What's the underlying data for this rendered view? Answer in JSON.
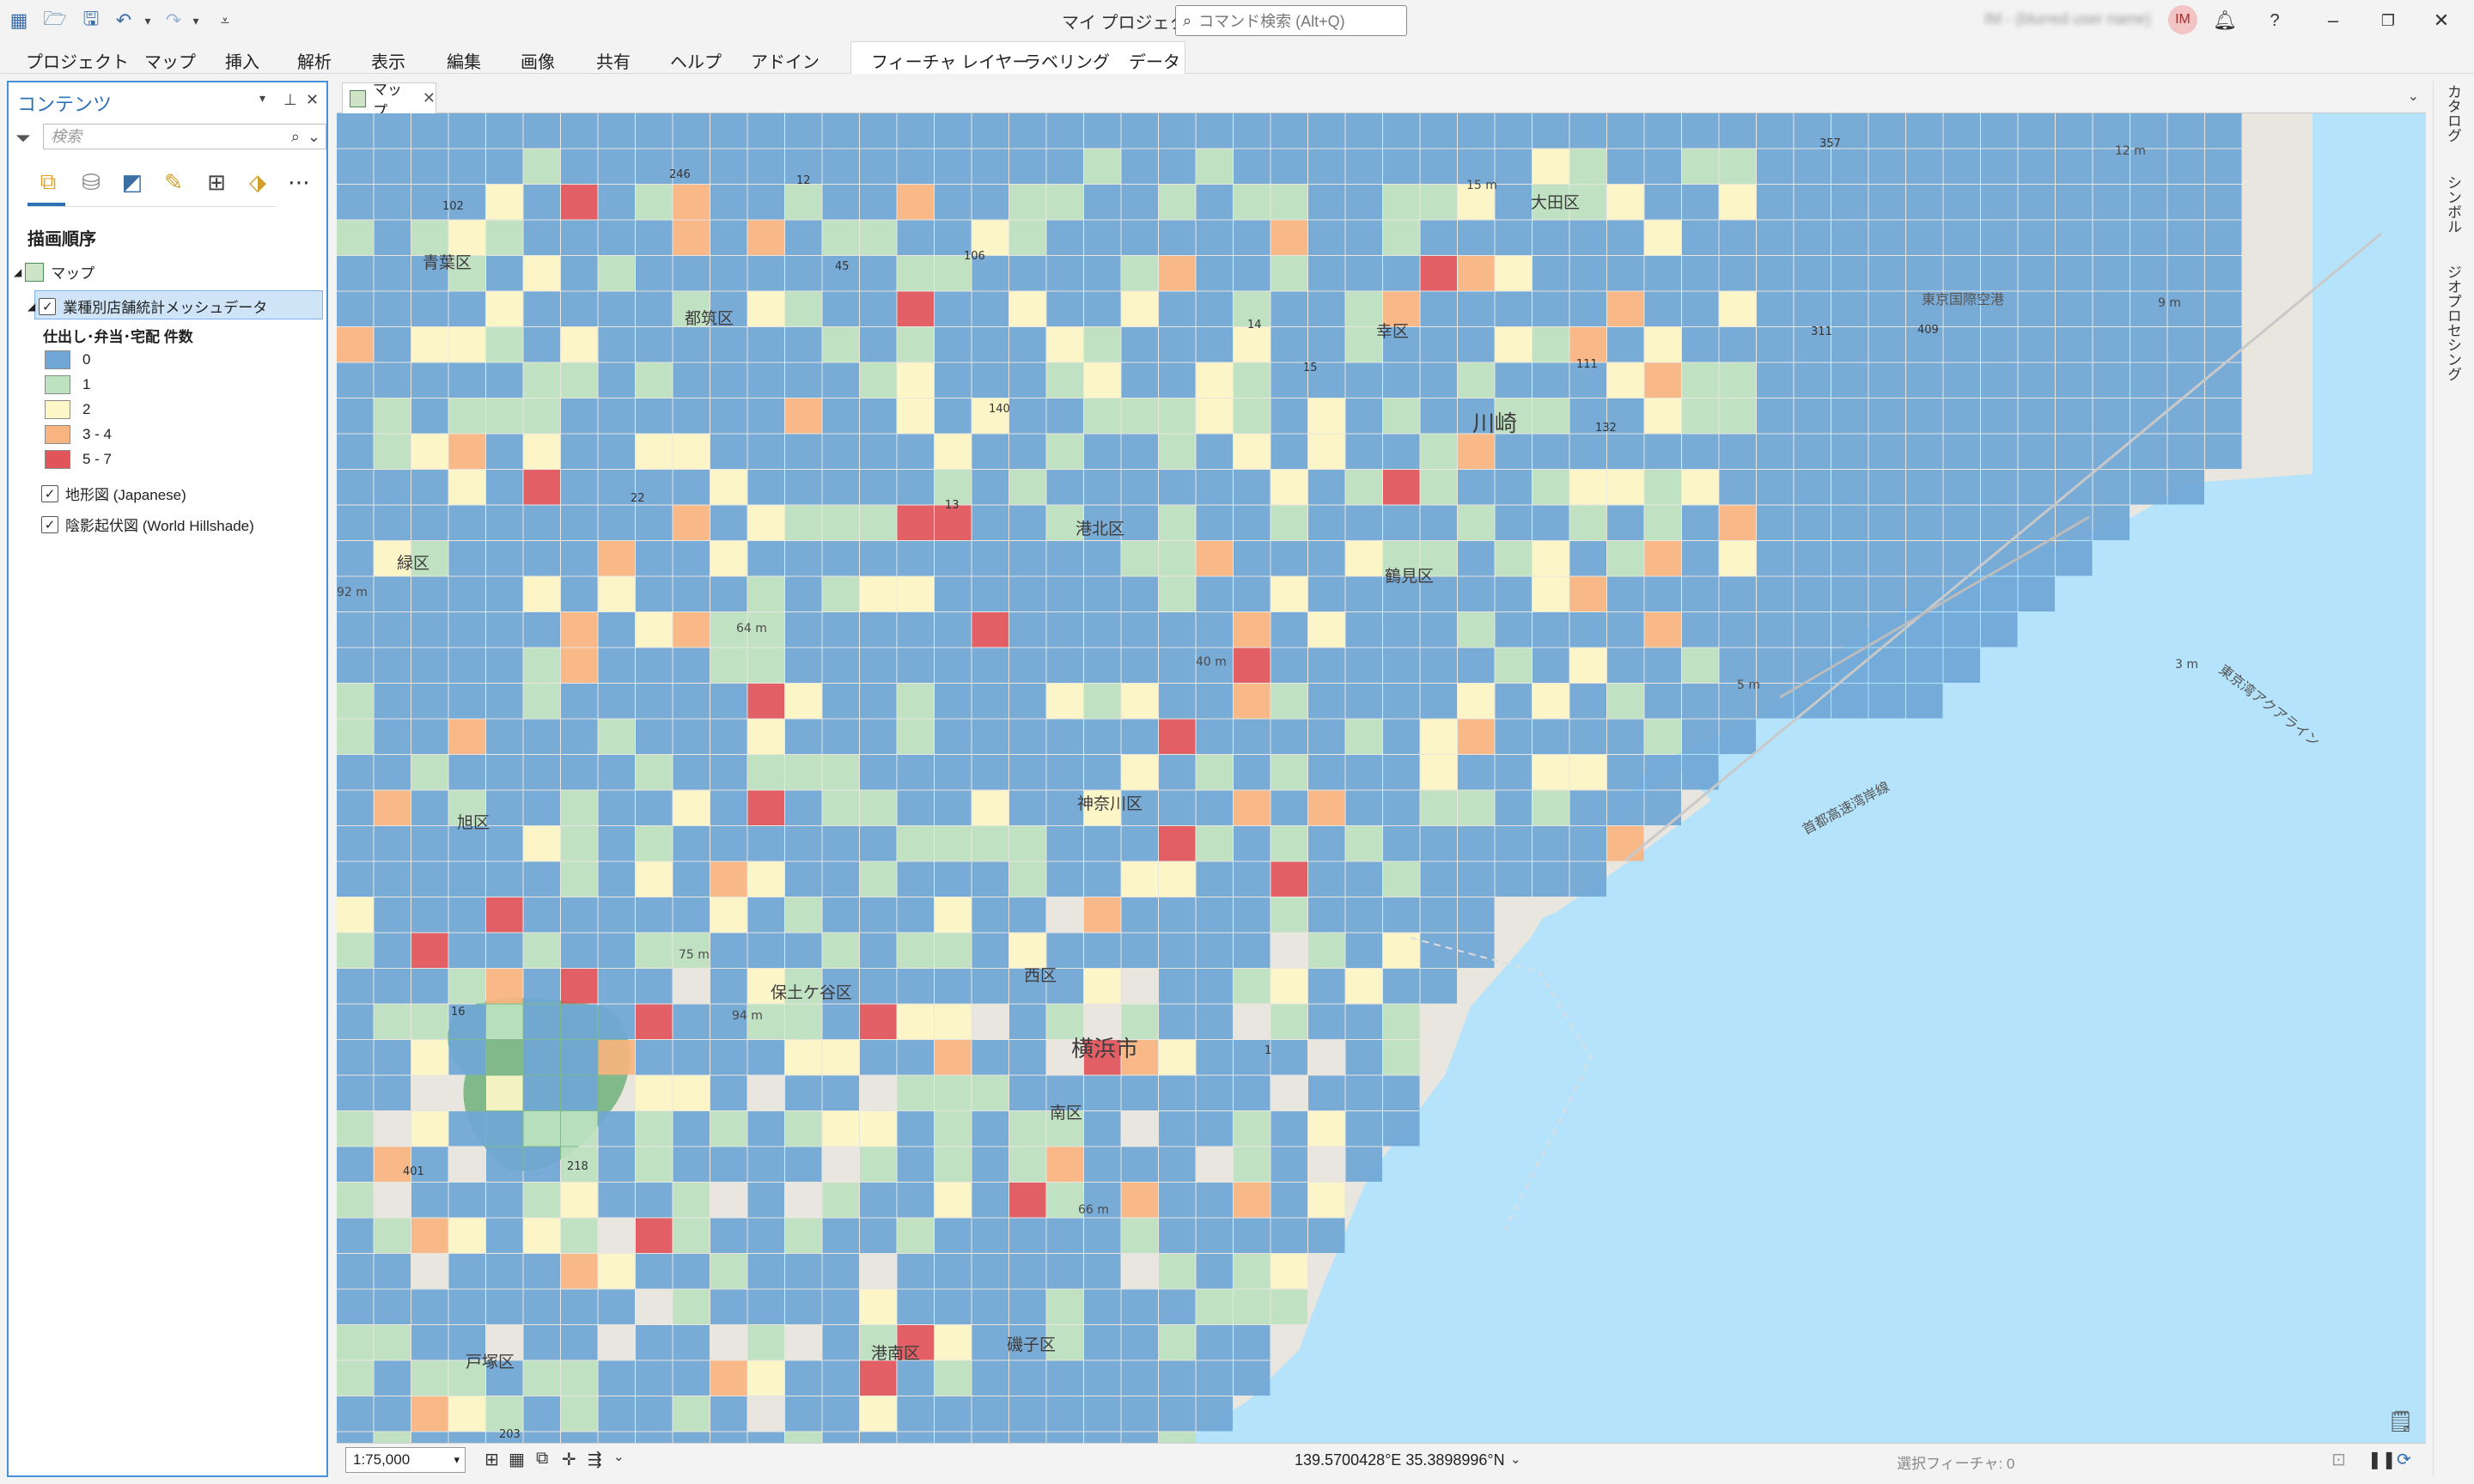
{
  "app": {
    "title": "マイ プロジェクト",
    "user_initials": "IM",
    "user_name": "IM - (blurred user name)"
  },
  "command_search": {
    "placeholder": "コマンド検索 (Alt+Q)"
  },
  "ribbon": {
    "tabs": [
      "プロジェクト",
      "マップ",
      "挿入",
      "解析",
      "表示",
      "編集",
      "画像",
      "共有",
      "ヘルプ",
      "アドイン"
    ],
    "contextual_tabs": [
      "フィーチャ レイヤー",
      "ラベリング",
      "データ"
    ]
  },
  "contents": {
    "title": "コンテンツ",
    "search_placeholder": "検索",
    "drawing_order_label": "描画順序",
    "map_node": "マップ",
    "layer_name": "業種別店舗統計メッシュデータ",
    "field_label": "仕出し･弁当･宅配 件数",
    "legend": [
      {
        "label": "0",
        "color": "#6fa6d6"
      },
      {
        "label": "1",
        "color": "#bde2bf"
      },
      {
        "label": "2",
        "color": "#fdf6c6"
      },
      {
        "label": "3 - 4",
        "color": "#f8b480"
      },
      {
        "label": "5 - 7",
        "color": "#e0545a"
      }
    ],
    "basemaps": [
      "地形図 (Japanese)",
      "陰影起伏図 (World Hillshade)"
    ]
  },
  "map_tab": {
    "label": "マップ"
  },
  "side_panel": {
    "tabs": [
      "カタログ",
      "シンボル",
      "ジオプロセシング"
    ]
  },
  "status": {
    "scale": "1:75,000",
    "coordinates": "139.5700428°E 35.3898996°N",
    "selected_features": "選択フィーチャ: 0"
  },
  "map_labels": {
    "wards": [
      "大田区",
      "青葉区",
      "都筑区",
      "幸区",
      "港北区",
      "緑区",
      "鶴見区",
      "神奈川区",
      "旭区",
      "保土ケ谷区",
      "西区",
      "南区",
      "戸塚区",
      "港南区",
      "磯子区"
    ],
    "cities": [
      "川崎",
      "横浜市"
    ],
    "facilities": [
      "東京国際空港",
      "東京湾アクアライン",
      "首都高速湾岸線"
    ],
    "roads": [
      "246",
      "102",
      "12",
      "45",
      "106",
      "140",
      "13",
      "14",
      "15",
      "111",
      "132",
      "409",
      "311",
      "357",
      "16",
      "401",
      "218",
      "203",
      "1",
      "22"
    ],
    "depths": [
      "12 m",
      "9 m",
      "3 m",
      "5 m",
      "15 m",
      "64 m",
      "75 m",
      "94 m",
      "66 m",
      "40 m",
      "92 m"
    ]
  },
  "mesh_colors": {
    "c0": "#6fa6d6",
    "c1": "#bde2bf",
    "c2": "#fdf6c6",
    "c3": "#f8b480",
    "c5": "#e0545a"
  }
}
